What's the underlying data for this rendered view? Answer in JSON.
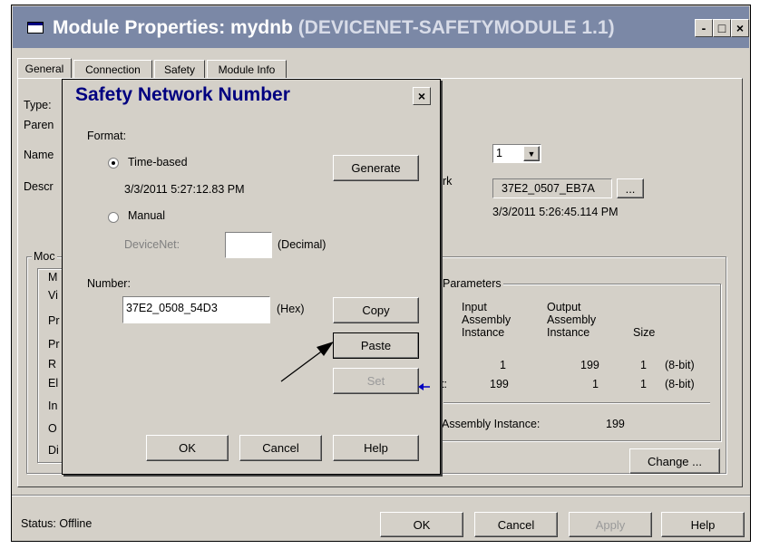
{
  "window": {
    "title": "Module Properties: mydnb",
    "title_suffix": " (DEVICENET-SAFETYMODULE 1.1)",
    "minimize": "-",
    "maximize": "□",
    "close": "×"
  },
  "tabs": [
    "General",
    "Connection",
    "Safety",
    "Module Info"
  ],
  "general": {
    "type_label": "Type:",
    "parent_label": "Paren",
    "name_label": "Name",
    "desc_label": "Descr",
    "node_value": "1",
    "network_label": "ork",
    "network_number": "37E2_0507_EB7A",
    "network_btn": "...",
    "network_timestamp": "3/3/2011 5:26:45.114 PM",
    "module_group_label": "Moc",
    "left_letters": [
      "M",
      "Vi",
      "Pr",
      "Pr",
      "R",
      "El",
      "In",
      "O",
      "Di"
    ],
    "params_title": "Parameters",
    "col_input": "Input Assembly Instance",
    "col_output": "Output Assembly Instance",
    "col_size": "Size",
    "rows": [
      {
        "label": "",
        "input": "1",
        "output": "199",
        "size": "1",
        "bits": "(8-bit)"
      },
      {
        "label": "t:",
        "input": "199",
        "output": "1",
        "size": "1",
        "bits": "(8-bit)"
      }
    ],
    "assembly_label": "Assembly Instance:",
    "assembly_value": "199",
    "change_btn": "Change ..."
  },
  "status": {
    "text": "Status:  Offline",
    "ok": "OK",
    "cancel": "Cancel",
    "apply": "Apply",
    "help": "Help"
  },
  "dialog": {
    "title": "Safety Network Number",
    "close": "×",
    "format_label": "Format:",
    "time_based": "Time-based",
    "timestamp": "3/3/2011 5:27:12.83 PM",
    "generate": "Generate",
    "manual": "Manual",
    "devicenet_label": "DeviceNet:",
    "decimal_label": "(Decimal)",
    "number_label": "Number:",
    "number_value": "37E2_0508_54D3",
    "hex_label": "(Hex)",
    "copy": "Copy",
    "paste": "Paste",
    "set": "Set",
    "ok": "OK",
    "cancel": "Cancel",
    "help": "Help"
  },
  "colors": {
    "title_bar": "#7b88a6",
    "dialog_title": "#000080",
    "face": "#d4d0c8",
    "arrow_blue": "#0000c0"
  }
}
